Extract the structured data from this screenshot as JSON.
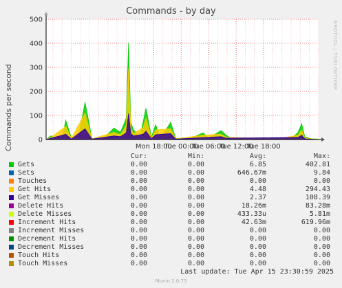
{
  "chart_data": {
    "type": "area",
    "title": "Commands - by day",
    "ylabel": "Commands per second",
    "ylim": [
      0,
      500
    ],
    "yticks": [
      "0",
      "100",
      "200",
      "300",
      "400",
      "500"
    ],
    "x_ticks": [
      "Mon 18:00",
      "Tue 00:00",
      "Tue 06:00",
      "Tue 12:00",
      "Tue 18:00"
    ],
    "x_hours": [
      -29.5,
      30
    ],
    "x_tick_hours": [
      -6,
      0,
      6,
      12,
      18
    ],
    "grid": true,
    "series": [
      {
        "name": "Gets",
        "color": "#00cc00",
        "points": [
          [
            -29.5,
            0
          ],
          [
            -28.5,
            15
          ],
          [
            -26.0,
            5
          ],
          [
            -25.2,
            80
          ],
          [
            -24.0,
            8
          ],
          [
            -22.5,
            5
          ],
          [
            -21.0,
            155
          ],
          [
            -19.5,
            5
          ],
          [
            -17.0,
            3
          ],
          [
            -14.7,
            48
          ],
          [
            -13.3,
            30
          ],
          [
            -12.6,
            60
          ],
          [
            -12.0,
            90
          ],
          [
            -11.5,
            402.81
          ],
          [
            -11.0,
            70
          ],
          [
            -10.4,
            40
          ],
          [
            -9.0,
            10
          ],
          [
            -8.3,
            75
          ],
          [
            -7.7,
            130
          ],
          [
            -6.5,
            10
          ],
          [
            -5.6,
            62
          ],
          [
            -4.5,
            5
          ],
          [
            -2.3,
            72
          ],
          [
            -1.2,
            5
          ],
          [
            2.0,
            5
          ],
          [
            4.8,
            28
          ],
          [
            6.0,
            5
          ],
          [
            8.7,
            38
          ],
          [
            9.8,
            18
          ],
          [
            11.0,
            5
          ],
          [
            14.0,
            3
          ],
          [
            18.0,
            3
          ],
          [
            21.0,
            6
          ],
          [
            24.0,
            3
          ],
          [
            25.5,
            30
          ],
          [
            26.3,
            66
          ],
          [
            27.0,
            10
          ],
          [
            28.5,
            3
          ],
          [
            30,
            2
          ]
        ]
      },
      {
        "name": "Get Hits",
        "color": "#ffcc00",
        "points": [
          [
            -29.5,
            0
          ],
          [
            -28.5,
            8
          ],
          [
            -25.2,
            55
          ],
          [
            -24.0,
            4
          ],
          [
            -21.0,
            110
          ],
          [
            -19.5,
            3
          ],
          [
            -14.7,
            30
          ],
          [
            -13.3,
            20
          ],
          [
            -12.6,
            40
          ],
          [
            -12.0,
            60
          ],
          [
            -11.5,
            294.43
          ],
          [
            -11.0,
            45
          ],
          [
            -10.4,
            25
          ],
          [
            -8.3,
            50
          ],
          [
            -7.7,
            90
          ],
          [
            -6.5,
            6
          ],
          [
            -5.6,
            40
          ],
          [
            -2.3,
            45
          ],
          [
            -1.2,
            3
          ],
          [
            4.8,
            18
          ],
          [
            8.7,
            22
          ],
          [
            9.8,
            10
          ],
          [
            21.0,
            3
          ],
          [
            25.5,
            18
          ],
          [
            26.3,
            40
          ],
          [
            27.0,
            5
          ],
          [
            30,
            1
          ]
        ]
      },
      {
        "name": "Get Misses",
        "color": "#330099",
        "points": [
          [
            -29.5,
            0
          ],
          [
            -28.5,
            5
          ],
          [
            -25.2,
            22
          ],
          [
            -24.0,
            2
          ],
          [
            -21.0,
            45
          ],
          [
            -19.5,
            2
          ],
          [
            -14.7,
            15
          ],
          [
            -13.3,
            12
          ],
          [
            -12.6,
            20
          ],
          [
            -12.0,
            28
          ],
          [
            -11.5,
            108.39
          ],
          [
            -11.0,
            25
          ],
          [
            -10.4,
            15
          ],
          [
            -8.3,
            22
          ],
          [
            -7.7,
            35
          ],
          [
            -6.5,
            3
          ],
          [
            -5.6,
            20
          ],
          [
            -2.3,
            25
          ],
          [
            -1.2,
            2
          ],
          [
            4.8,
            8
          ],
          [
            8.7,
            12
          ],
          [
            9.8,
            6
          ],
          [
            25.5,
            9
          ],
          [
            26.3,
            18
          ],
          [
            27.0,
            3
          ],
          [
            30,
            0
          ]
        ]
      }
    ]
  },
  "legend": {
    "headers": {
      "cur": "Cur:",
      "min": "Min:",
      "avg": "Avg:",
      "max": "Max:"
    },
    "rows": [
      {
        "name": "Gets",
        "color": "#00cc00",
        "cur": "0.00",
        "min": "0.00",
        "avg": "6.85",
        "max": "402.81"
      },
      {
        "name": "Sets",
        "color": "#0066b3",
        "cur": "0.00",
        "min": "0.00",
        "avg": "646.67m",
        "max": "9.84"
      },
      {
        "name": "Touches",
        "color": "#ff8000",
        "cur": "0.00",
        "min": "0.00",
        "avg": "0.00",
        "max": "0.00"
      },
      {
        "name": "Get Hits",
        "color": "#ffcc00",
        "cur": "0.00",
        "min": "0.00",
        "avg": "4.48",
        "max": "294.43"
      },
      {
        "name": "Get Misses",
        "color": "#330099",
        "cur": "0.00",
        "min": "0.00",
        "avg": "2.37",
        "max": "108.39"
      },
      {
        "name": "Delete Hits",
        "color": "#990099",
        "cur": "0.00",
        "min": "0.00",
        "avg": "18.26m",
        "max": "83.28m"
      },
      {
        "name": "Delete Misses",
        "color": "#ccff00",
        "cur": "0.00",
        "min": "0.00",
        "avg": "433.33u",
        "max": "5.81m"
      },
      {
        "name": "Increment Hits",
        "color": "#ff0000",
        "cur": "0.00",
        "min": "0.00",
        "avg": "42.63m",
        "max": "619.96m"
      },
      {
        "name": "Increment Misses",
        "color": "#808080",
        "cur": "0.00",
        "min": "0.00",
        "avg": "0.00",
        "max": "0.00"
      },
      {
        "name": "Decrement Hits",
        "color": "#008f00",
        "cur": "0.00",
        "min": "0.00",
        "avg": "0.00",
        "max": "0.00"
      },
      {
        "name": "Decrement Misses",
        "color": "#00487d",
        "cur": "0.00",
        "min": "0.00",
        "avg": "0.00",
        "max": "0.00"
      },
      {
        "name": "Touch Hits",
        "color": "#b35a00",
        "cur": "0.00",
        "min": "0.00",
        "avg": "0.00",
        "max": "0.00"
      },
      {
        "name": "Touch Misses",
        "color": "#b38f00",
        "cur": "0.00",
        "min": "0.00",
        "avg": "0.00",
        "max": "0.00"
      }
    ]
  },
  "last_update": "Last update: Tue Apr 15 23:30:59 2025",
  "version": "Munin 2.0.73",
  "watermark": "RRDTOOL / TOBI OETIKER"
}
